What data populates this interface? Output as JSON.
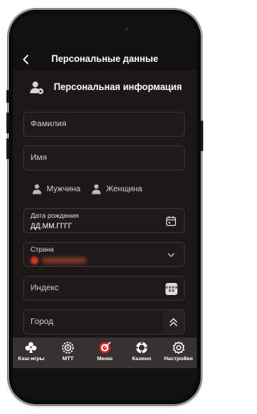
{
  "header": {
    "title": "Персональные данные"
  },
  "section": {
    "title": "Персональная информация"
  },
  "fields": {
    "surname": {
      "placeholder": "Фамилия"
    },
    "name": {
      "placeholder": "Имя"
    },
    "birthdate": {
      "label": "Дата рождения",
      "placeholder": "ДД.ММ.ГГГГ"
    },
    "country": {
      "label": "Страна"
    },
    "index": {
      "placeholder": "Индекс"
    },
    "city": {
      "placeholder": "Город"
    }
  },
  "gender": {
    "male_label": "Мужчина",
    "female_label": "Женщина"
  },
  "bottom_nav": [
    {
      "label": "Кэш-игры",
      "icon": "cash-games-icon"
    },
    {
      "label": "МТТ",
      "icon": "mtt-icon"
    },
    {
      "label": "Меню",
      "icon": "menu-target-icon"
    },
    {
      "label": "Казино",
      "icon": "casino-chip-icon"
    },
    {
      "label": "Настройки",
      "icon": "settings-gear-icon"
    }
  ],
  "colors": {
    "background": "#1c1818",
    "bar": "#121010",
    "field_border": "#3b3434",
    "nav_background": "#373131",
    "accent_red": "#e0201c"
  }
}
